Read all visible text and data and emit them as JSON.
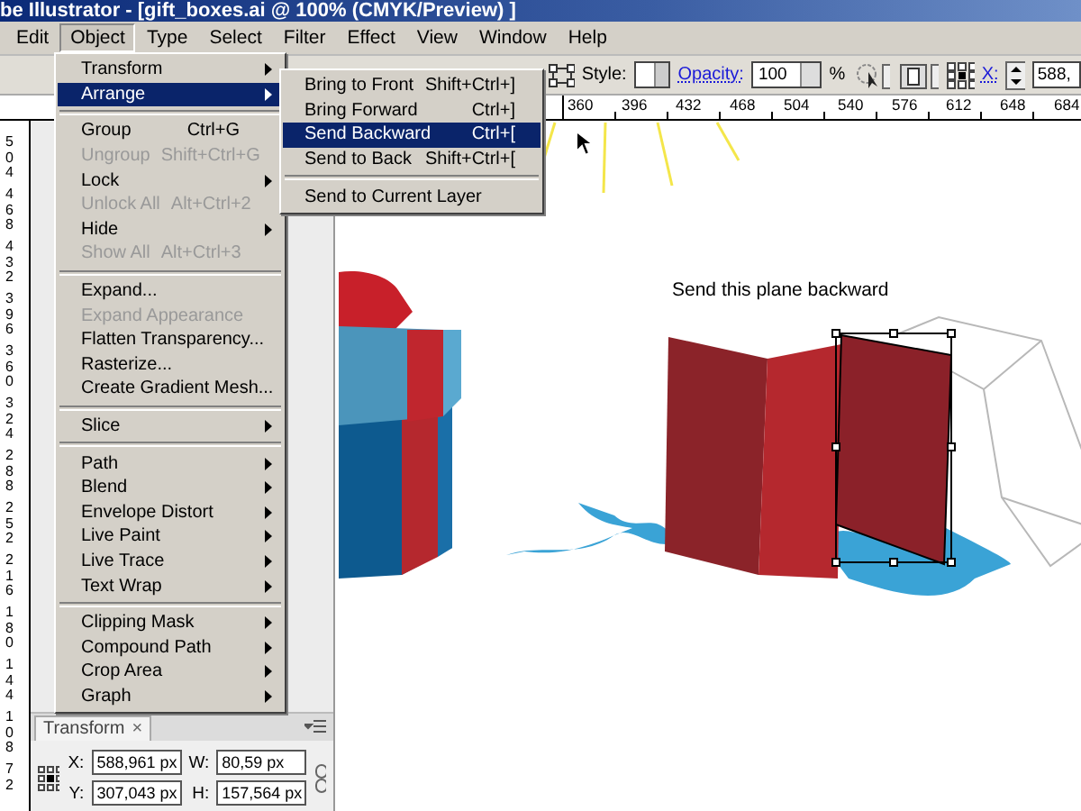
{
  "title_bar": {
    "title": "be Illustrator - [gift_boxes.ai @ 100% (CMYK/Preview) ]"
  },
  "menu_bar": [
    {
      "label": "Edit",
      "selected": false
    },
    {
      "label": "Object",
      "selected": true
    },
    {
      "label": "Type",
      "selected": false
    },
    {
      "label": "Select",
      "selected": false
    },
    {
      "label": "Filter",
      "selected": false
    },
    {
      "label": "Effect",
      "selected": false
    },
    {
      "label": "View",
      "selected": false
    },
    {
      "label": "Window",
      "selected": false
    },
    {
      "label": "Help",
      "selected": false
    }
  ],
  "control_bar": {
    "style_label": "Style:",
    "opacity_label": "Opacity:",
    "opacity_value": "100",
    "percent": "%",
    "x_label": "X:",
    "x_value": "588,"
  },
  "rulers": {
    "horizontal": [
      "360",
      "396",
      "432",
      "468",
      "504",
      "540",
      "576",
      "612",
      "648",
      "684"
    ],
    "vertical": [
      "504",
      "468",
      "432",
      "396",
      "360",
      "324",
      "288",
      "252",
      "216",
      "180",
      "144",
      "108",
      "72"
    ]
  },
  "object_menu": {
    "items": [
      {
        "kind": "item",
        "label": "Transform",
        "submenu": true,
        "disabled": false,
        "selected": false
      },
      {
        "kind": "item",
        "label": "Arrange",
        "submenu": true,
        "disabled": false,
        "selected": true
      },
      {
        "kind": "separator"
      },
      {
        "kind": "item",
        "label": "Group",
        "shortcut": "Ctrl+G",
        "submenu": false,
        "disabled": false,
        "selected": false
      },
      {
        "kind": "item",
        "label": "Ungroup",
        "shortcut": "Shift+Ctrl+G",
        "submenu": false,
        "disabled": true,
        "selected": false
      },
      {
        "kind": "item",
        "label": "Lock",
        "submenu": true,
        "disabled": false,
        "selected": false
      },
      {
        "kind": "item",
        "label": "Unlock All",
        "shortcut": "Alt+Ctrl+2",
        "submenu": false,
        "disabled": true,
        "selected": false
      },
      {
        "kind": "item",
        "label": "Hide",
        "submenu": true,
        "disabled": false,
        "selected": false
      },
      {
        "kind": "item",
        "label": "Show All",
        "shortcut": "Alt+Ctrl+3",
        "submenu": false,
        "disabled": true,
        "selected": false
      },
      {
        "kind": "separator"
      },
      {
        "kind": "item",
        "label": "Expand...",
        "submenu": false,
        "disabled": false,
        "selected": false
      },
      {
        "kind": "item",
        "label": "Expand Appearance",
        "submenu": false,
        "disabled": true,
        "selected": false
      },
      {
        "kind": "item",
        "label": "Flatten Transparency...",
        "submenu": false,
        "disabled": false,
        "selected": false
      },
      {
        "kind": "item",
        "label": "Rasterize...",
        "submenu": false,
        "disabled": false,
        "selected": false
      },
      {
        "kind": "item",
        "label": "Create Gradient Mesh...",
        "submenu": false,
        "disabled": false,
        "selected": false
      },
      {
        "kind": "separator"
      },
      {
        "kind": "item",
        "label": "Slice",
        "submenu": true,
        "disabled": false,
        "selected": false
      },
      {
        "kind": "separator"
      },
      {
        "kind": "item",
        "label": "Path",
        "submenu": true,
        "disabled": false,
        "selected": false
      },
      {
        "kind": "item",
        "label": "Blend",
        "submenu": true,
        "disabled": false,
        "selected": false
      },
      {
        "kind": "item",
        "label": "Envelope Distort",
        "submenu": true,
        "disabled": false,
        "selected": false
      },
      {
        "kind": "item",
        "label": "Live Paint",
        "submenu": true,
        "disabled": false,
        "selected": false
      },
      {
        "kind": "item",
        "label": "Live Trace",
        "submenu": true,
        "disabled": false,
        "selected": false
      },
      {
        "kind": "item",
        "label": "Text Wrap",
        "submenu": true,
        "disabled": false,
        "selected": false
      },
      {
        "kind": "separator"
      },
      {
        "kind": "item",
        "label": "Clipping Mask",
        "submenu": true,
        "disabled": false,
        "selected": false
      },
      {
        "kind": "item",
        "label": "Compound Path",
        "submenu": true,
        "disabled": false,
        "selected": false
      },
      {
        "kind": "item",
        "label": "Crop Area",
        "submenu": true,
        "disabled": false,
        "selected": false
      },
      {
        "kind": "item",
        "label": "Graph",
        "submenu": true,
        "disabled": false,
        "selected": false
      }
    ]
  },
  "arrange_submenu": {
    "items": [
      {
        "kind": "item",
        "label": "Bring to Front",
        "shortcut": "Shift+Ctrl+]",
        "selected": false
      },
      {
        "kind": "item",
        "label": "Bring Forward",
        "shortcut": "Ctrl+]",
        "selected": false
      },
      {
        "kind": "item",
        "label": "Send Backward",
        "shortcut": "Ctrl+[",
        "selected": true
      },
      {
        "kind": "item",
        "label": "Send to Back",
        "shortcut": "Shift+Ctrl+[",
        "selected": false
      },
      {
        "kind": "separator"
      },
      {
        "kind": "item",
        "label": "Send to Current Layer",
        "selected": false
      }
    ]
  },
  "canvas": {
    "annotation": "Send this plane backward"
  },
  "transform_panel": {
    "tab": "Transform",
    "close": "×",
    "fields": [
      {
        "label": "X:",
        "value": "588,961 px"
      },
      {
        "label": "W:",
        "value": "80,59 px"
      },
      {
        "label": "Y:",
        "value": "307,043 px"
      },
      {
        "label": "H:",
        "value": "157,564 px"
      }
    ]
  }
}
